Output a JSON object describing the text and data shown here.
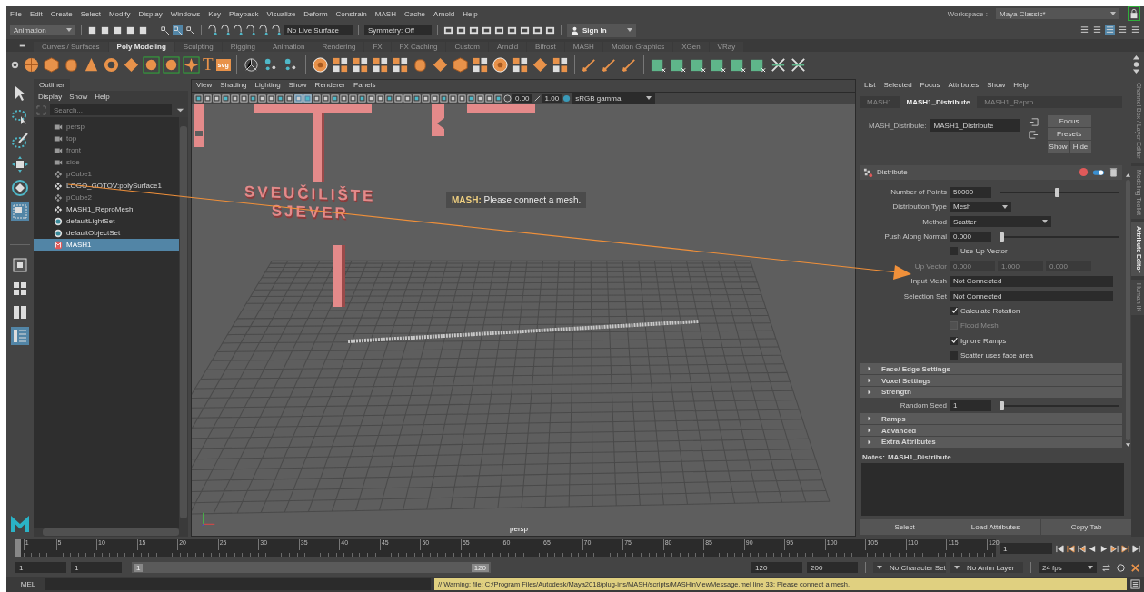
{
  "menu_bar": {
    "menus": [
      "File",
      "Edit",
      "Create",
      "Select",
      "Modify",
      "Display",
      "Windows",
      "Key",
      "Playback",
      "Visualize",
      "Deform",
      "Constrain",
      "MASH",
      "Cache",
      "Arnold",
      "Help"
    ],
    "workspace_label": "Workspace :",
    "workspace": "Maya Classic*"
  },
  "status_line": {
    "mode": "Animation",
    "live_surface": "No Live Surface",
    "symmetry": "Symmetry: Off",
    "sign_in": "Sign In"
  },
  "shelf": {
    "tabs": [
      {
        "label": "Curves / Surfaces",
        "selected": false
      },
      {
        "label": "Poly Modeling",
        "selected": true
      },
      {
        "label": "Sculpting",
        "selected": false
      },
      {
        "label": "Rigging",
        "selected": false
      },
      {
        "label": "Animation",
        "selected": false
      },
      {
        "label": "Rendering",
        "selected": false
      },
      {
        "label": "FX",
        "selected": false
      },
      {
        "label": "FX Caching",
        "selected": false
      },
      {
        "label": "Custom",
        "selected": false
      },
      {
        "label": "Arnold",
        "selected": false
      },
      {
        "label": "Bifrost",
        "selected": false
      },
      {
        "label": "MASH",
        "selected": false
      },
      {
        "label": "Motion Graphics",
        "selected": false
      },
      {
        "label": "XGen",
        "selected": false
      },
      {
        "label": "VRay",
        "selected": false
      }
    ],
    "type_tool": "T",
    "svg_tool": "svg"
  },
  "outliner": {
    "title": "Outliner",
    "menus": [
      "Display",
      "Show",
      "Help"
    ],
    "search": {
      "placeholder": "Search..."
    },
    "items": [
      {
        "label": "persp",
        "kind": "camera",
        "disabled": true,
        "selected": false
      },
      {
        "label": "top",
        "kind": "camera",
        "disabled": true,
        "selected": false
      },
      {
        "label": "front",
        "kind": "camera",
        "disabled": true,
        "selected": false
      },
      {
        "label": "side",
        "kind": "camera",
        "disabled": true,
        "selected": false
      },
      {
        "label": "pCube1",
        "kind": "transform",
        "disabled": true,
        "selected": false
      },
      {
        "label": "LOGO_GOTOV:polySurface1",
        "kind": "transform",
        "disabled": false,
        "selected": false
      },
      {
        "label": "pCube2",
        "kind": "transform",
        "disabled": true,
        "selected": false
      },
      {
        "label": "MASH1_ReproMesh",
        "kind": "transform",
        "disabled": false,
        "selected": false
      },
      {
        "label": "defaultLightSet",
        "kind": "set",
        "disabled": false,
        "selected": false
      },
      {
        "label": "defaultObjectSet",
        "kind": "set",
        "disabled": false,
        "selected": false
      },
      {
        "label": "MASH1",
        "kind": "mash",
        "disabled": false,
        "selected": true
      }
    ]
  },
  "viewport": {
    "menus": [
      "View",
      "Shading",
      "Lighting",
      "Show",
      "Renderer",
      "Panels"
    ],
    "exposure": "0.00",
    "gamma": "1.00",
    "color_space": "sRGB gamma",
    "scene_text": [
      "SVEUČILIŠTE",
      "SJEVER"
    ],
    "message_label": "MASH:",
    "message": "Please connect a mesh.",
    "camera": "persp"
  },
  "attribute_editor": {
    "menus": [
      "List",
      "Selected",
      "Focus",
      "Attributes",
      "Show",
      "Help"
    ],
    "tabs": [
      {
        "label": "MASH1",
        "selected": false
      },
      {
        "label": "MASH1_Distribute",
        "selected": true
      },
      {
        "label": "MASH1_Repro",
        "selected": false
      }
    ],
    "node_label": "MASH_Distribute:",
    "node_name": "MASH1_Distribute",
    "buttons": [
      "Focus",
      "Presets",
      "Show",
      "Hide"
    ],
    "section_title": "Distribute",
    "enabled": true,
    "fields": [
      {
        "kind": "slider",
        "label": "Number of Points",
        "value": "50000",
        "level": 0.49
      },
      {
        "kind": "dropdown",
        "label": "Distribution Type",
        "value": "Mesh"
      },
      {
        "kind": "dropdown",
        "label": "Method",
        "value": "Scatter"
      },
      {
        "kind": "slider",
        "label": "Push Along Normal",
        "value": "0.000",
        "level": 0
      },
      {
        "kind": "checkbox",
        "label": "Use Up Vector",
        "checked": false,
        "disabled": false
      },
      {
        "kind": "vector",
        "label": "Up Vector",
        "values": [
          "0.000",
          "1.000",
          "0.000"
        ],
        "disabled": true
      },
      {
        "kind": "text",
        "label": "Input Mesh",
        "value": "Not Connected"
      },
      {
        "kind": "text",
        "label": "Selection Set",
        "value": "Not Connected"
      },
      {
        "kind": "checkbox",
        "label": "Calculate Rotation",
        "checked": true,
        "disabled": false
      },
      {
        "kind": "checkbox",
        "label": "Flood Mesh",
        "checked": false,
        "disabled": true
      },
      {
        "kind": "checkbox",
        "label": "Ignore Ramps",
        "checked": true,
        "disabled": false
      },
      {
        "kind": "checkbox",
        "label": "Scatter uses face area",
        "checked": false,
        "disabled": false
      },
      {
        "kind": "section",
        "label": "Face/ Edge Settings",
        "expanded": false
      },
      {
        "kind": "section",
        "label": "Voxel Settings",
        "expanded": false
      },
      {
        "kind": "section",
        "label": "Strength",
        "expanded": false
      },
      {
        "kind": "slider",
        "label": "Random Seed",
        "value": "1",
        "level": 0
      },
      {
        "kind": "section",
        "label": "Ramps",
        "expanded": false
      },
      {
        "kind": "section",
        "label": "Advanced",
        "expanded": false
      },
      {
        "kind": "section",
        "label": "Extra Attributes",
        "expanded": false
      }
    ],
    "notes_label": "Notes:",
    "notes_node": "MASH1_Distribute",
    "bottom_buttons": [
      "Select",
      "Load Attributes",
      "Copy Tab"
    ]
  },
  "side_tabs": [
    {
      "label": "Channel Box / Layer Editor",
      "selected": false
    },
    {
      "label": "Modeling Toolkit",
      "selected": false
    },
    {
      "label": "Attribute Editor",
      "selected": true
    },
    {
      "label": "Human IK",
      "selected": false
    }
  ],
  "time_slider": {
    "ticks": [
      "1",
      "5",
      "10",
      "15",
      "20",
      "25",
      "30",
      "35",
      "40",
      "45",
      "50",
      "55",
      "60",
      "65",
      "70",
      "75",
      "80",
      "85",
      "90",
      "95",
      "100",
      "105",
      "110",
      "115",
      "120"
    ],
    "current_frame": "1"
  },
  "range_slider": {
    "level": 1,
    "start": "1",
    "playback_start": "1",
    "slider_start": "1",
    "slider_end": "120",
    "playback_end": "120",
    "end": "200",
    "character_set": "No Character Set",
    "anim_layer": "No Anim Layer",
    "fps": "24 fps"
  },
  "command_line": {
    "language": "MEL",
    "warning": "// Warning: file: C:/Program Files/Autodesk/Maya2018/plug-ins/MASH/scripts/MASHinViewMessage.mel line 33: Please connect a mesh."
  }
}
